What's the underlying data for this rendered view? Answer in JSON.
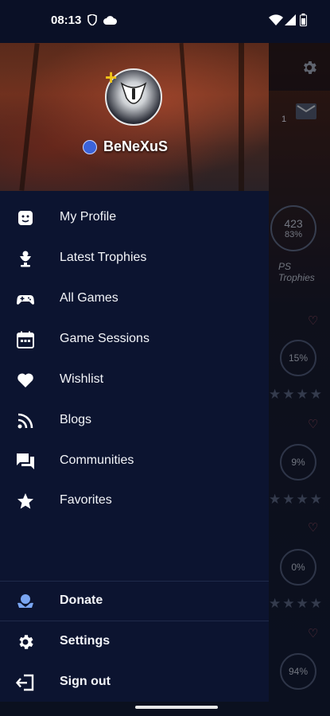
{
  "status_bar": {
    "time": "08:13",
    "icons": [
      "shield-icon",
      "cloud-icon",
      "wifi-icon",
      "signal-icon",
      "battery-icon"
    ]
  },
  "drawer": {
    "username": "BeNeXuS",
    "menu": [
      {
        "label": "My Profile",
        "icon": "profile-face-icon"
      },
      {
        "label": "Latest Trophies",
        "icon": "trophy-icon"
      },
      {
        "label": "All Games",
        "icon": "gamepad-icon"
      },
      {
        "label": "Game Sessions",
        "icon": "calendar-icon"
      },
      {
        "label": "Wishlist",
        "icon": "heart-icon"
      },
      {
        "label": "Blogs",
        "icon": "rss-icon"
      },
      {
        "label": "Communities",
        "icon": "forum-icon"
      },
      {
        "label": "Favorites",
        "icon": "star-icon"
      }
    ],
    "footer_menu": [
      {
        "label": "Donate",
        "icon": "donate-icon"
      },
      {
        "label": "Settings",
        "icon": "gear-icon"
      },
      {
        "label": "Sign out",
        "icon": "sign-out-icon"
      }
    ]
  },
  "background": {
    "trophy_count": "423",
    "trophy_percent": "83%",
    "trophy_caption": "PS Trophies",
    "badge_count": "1",
    "game_progress": [
      "15%",
      "9%",
      "0%",
      "94%"
    ]
  },
  "colors": {
    "drawer_bg": "#0c1430",
    "accent_blue": "#3b63d9",
    "text": "#f2f4f8"
  }
}
